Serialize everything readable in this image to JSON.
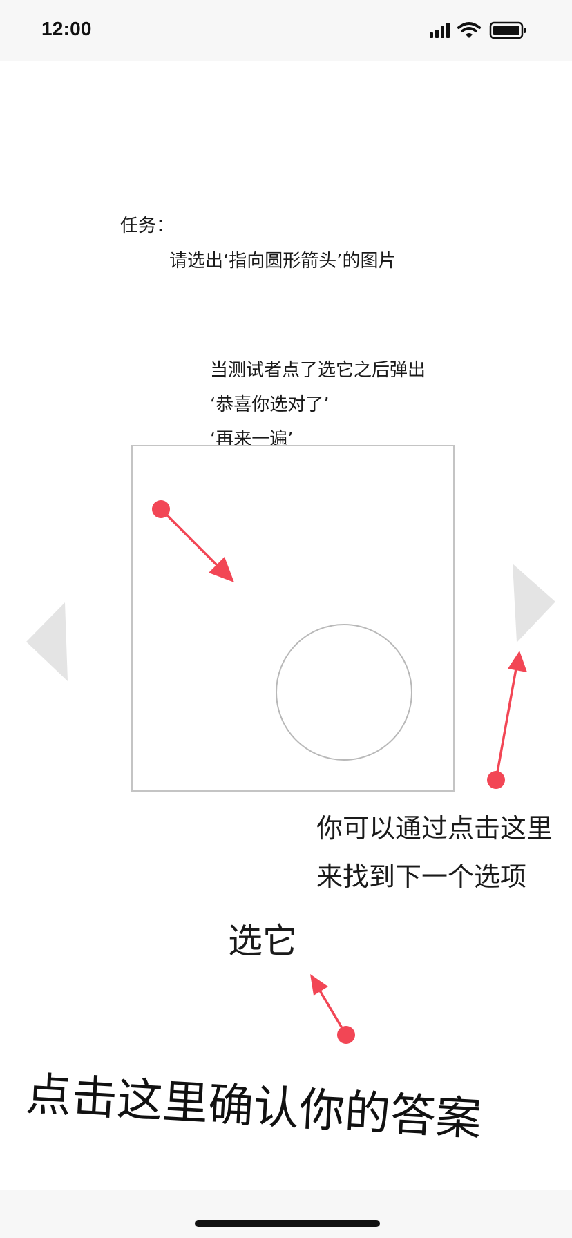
{
  "status_bar": {
    "time": "12:00",
    "icons": [
      "signal-icon",
      "wifi-icon",
      "battery-icon"
    ]
  },
  "task": {
    "label": "任务：",
    "instruction": "请选出‘指向圆形箭头’的图片"
  },
  "popup_note": {
    "lines": [
      "当测试者点了选它之后弹出",
      "‘恭喜你选对了’",
      "‘再来一遍’"
    ]
  },
  "navigation": {
    "prev_icon": "triangle-left-icon",
    "next_icon": "triangle-right-icon",
    "hint_lines": [
      "你可以通过点击这里",
      "来找到下一个选项"
    ]
  },
  "select": {
    "label": "选它"
  },
  "confirm_hint": {
    "text": "点击这里确认你的答案"
  },
  "colors": {
    "annotation_red": "#f24655",
    "nav_gray": "#e4e4e4",
    "card_border": "#c4c4c4",
    "circle_stroke": "#b8b8b8",
    "bar_bg": "#f7f7f7"
  }
}
